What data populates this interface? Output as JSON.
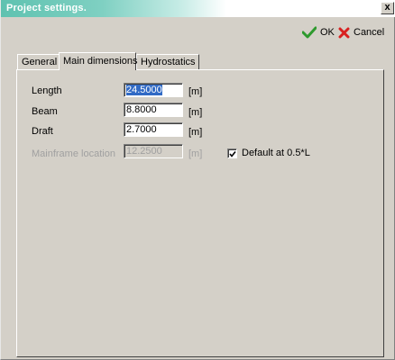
{
  "window": {
    "title": "Project settings.",
    "close_label": "x"
  },
  "toolbar": {
    "ok_label": "OK",
    "cancel_label": "Cancel"
  },
  "tabs": [
    {
      "label": "General",
      "active": false
    },
    {
      "label": "Main dimensions",
      "active": true
    },
    {
      "label": "Hydrostatics",
      "active": false
    }
  ],
  "fields": {
    "length": {
      "label": "Length",
      "value": "24.5000",
      "unit": "[m]"
    },
    "beam": {
      "label": "Beam",
      "value": "8.8000",
      "unit": "[m]"
    },
    "draft": {
      "label": "Draft",
      "value": "2.7000",
      "unit": "[m]"
    },
    "mainframe": {
      "label": "Mainframe location",
      "value": "12.2500",
      "unit": "[m]",
      "enabled": false
    }
  },
  "default_checkbox": {
    "label": "Default at 0.5*L",
    "checked": true
  },
  "colors": {
    "title_gradient_start": "#5fc2b0",
    "ok_icon": "#2e9a2e",
    "cancel_icon": "#d82020",
    "selection": "#316ac5"
  },
  "icons": {
    "ok": "checkmark-icon",
    "cancel": "x-icon"
  }
}
